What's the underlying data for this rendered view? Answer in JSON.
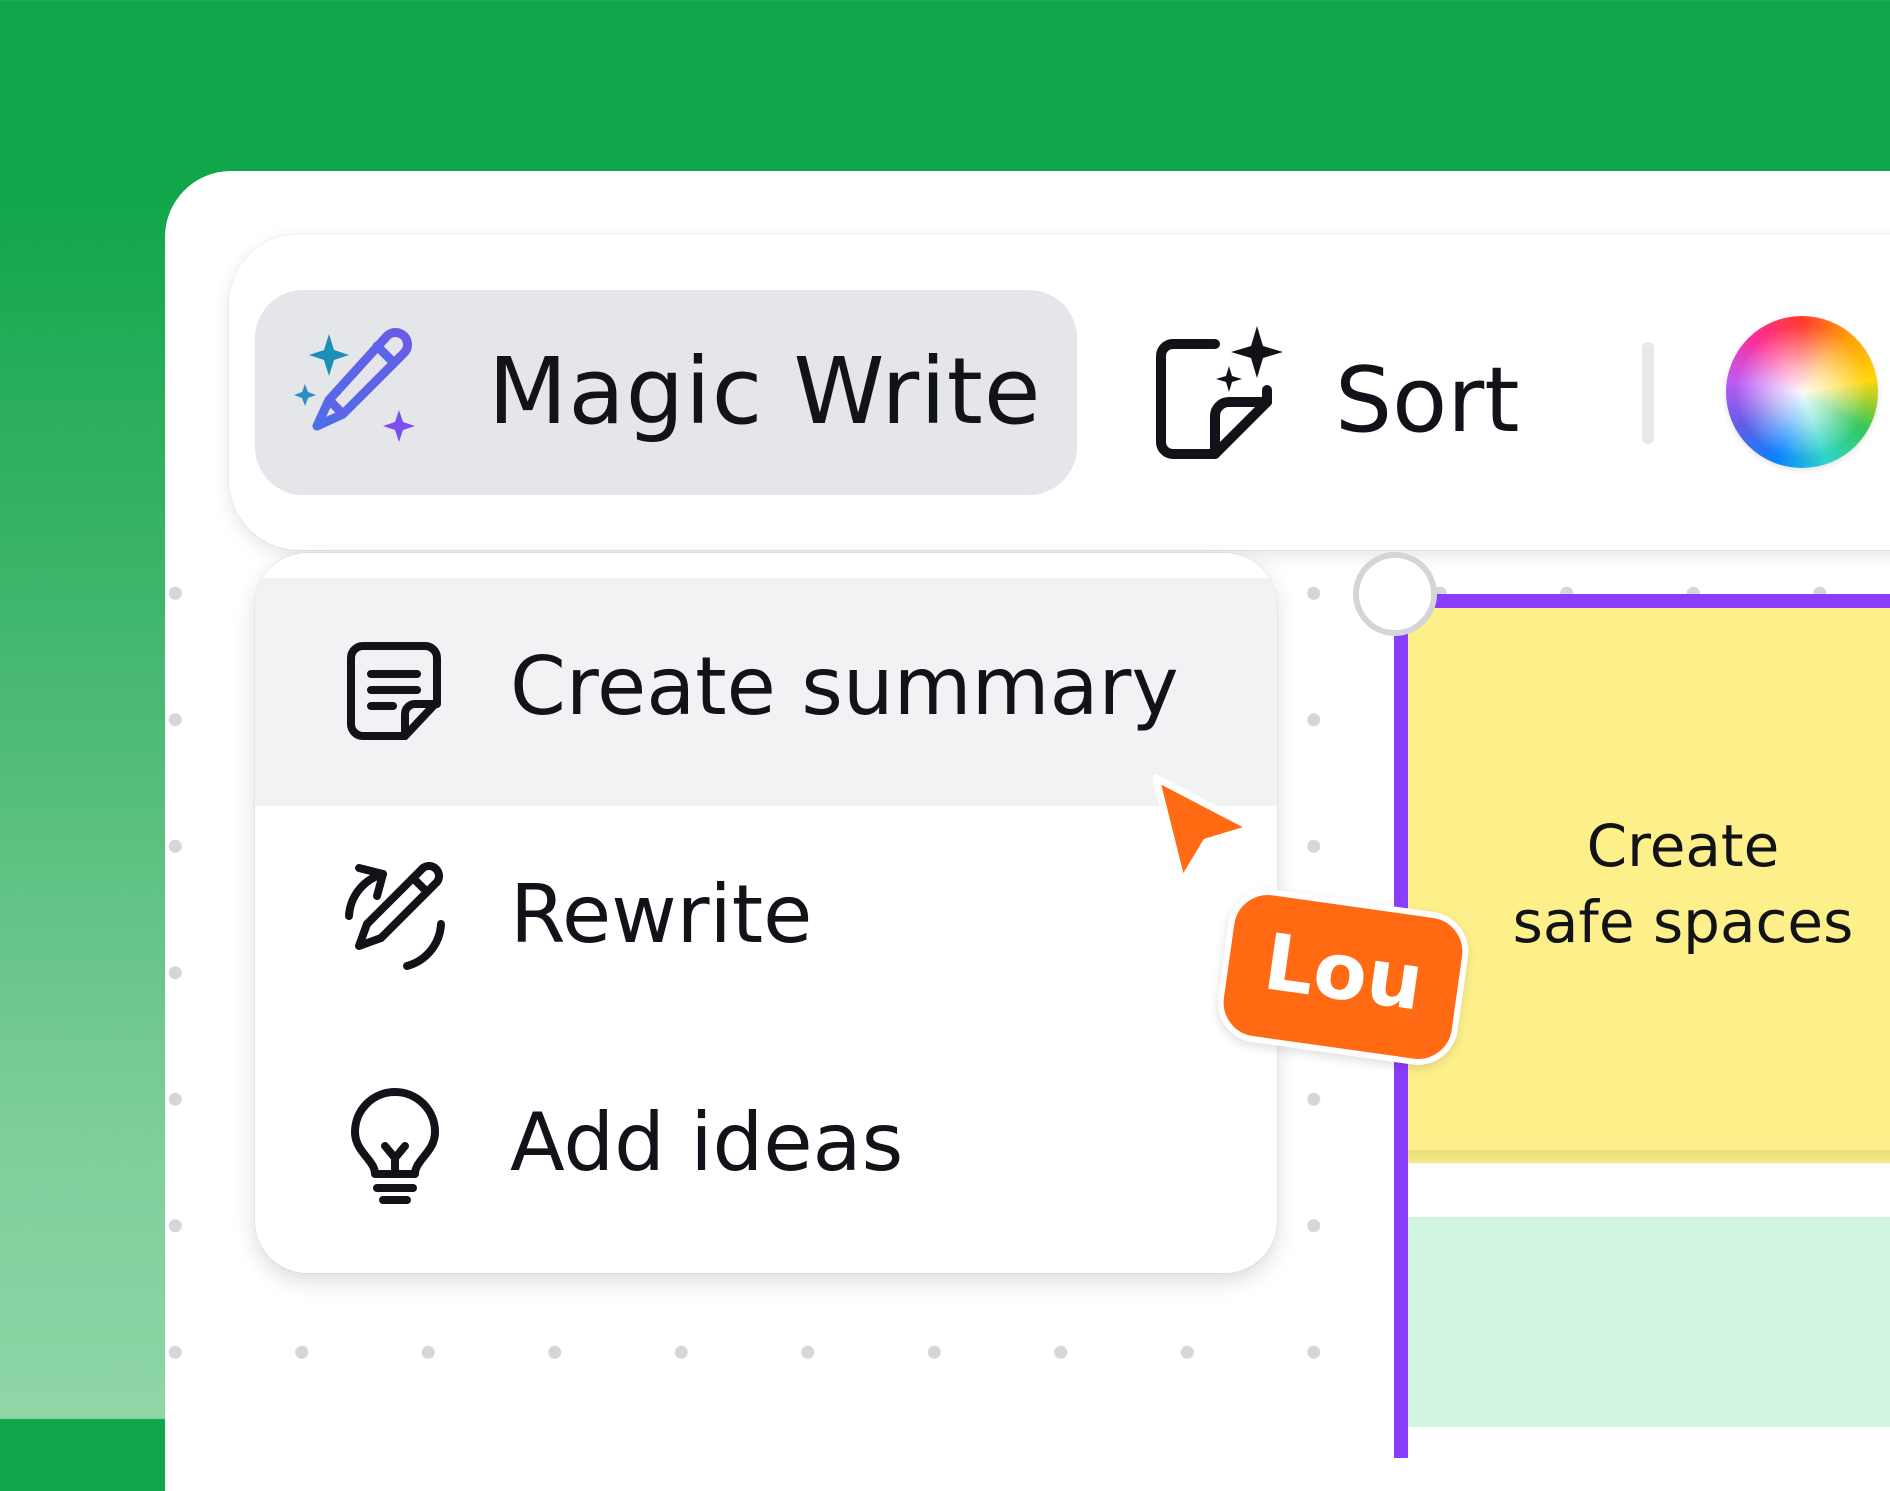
{
  "toolbar": {
    "magic_write_label": "Magic Write",
    "magic_write_icon": "magic-pencil-icon",
    "sort_label": "Sort",
    "sort_icon": "sparkle-sticky-note-icon",
    "color_picker_icon": "color-wheel-icon"
  },
  "menu": {
    "items": [
      {
        "label": "Create summary",
        "icon": "summary-note-icon",
        "active": true
      },
      {
        "label": "Rewrite",
        "icon": "rewrite-pencil-icon",
        "active": false
      },
      {
        "label": "Add ideas",
        "icon": "lightbulb-icon",
        "active": false
      }
    ]
  },
  "sticky_note": {
    "line1": "Create",
    "line2": "safe spaces",
    "color": "#fdf08a",
    "selection_color": "#8b3dff"
  },
  "collaborator": {
    "name": "Lou",
    "color": "#ff6a13"
  },
  "colors": {
    "background_top": "#10a64a",
    "background_bottom": "#8fd6a6",
    "accent_purple": "#8b3dff"
  }
}
